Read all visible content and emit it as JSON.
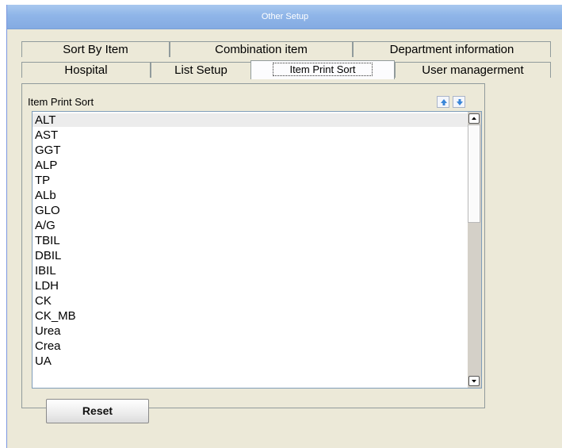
{
  "window": {
    "title": "Other Setup"
  },
  "tabs": {
    "row1": [
      "Sort By Item",
      "Combination item",
      "Department information"
    ],
    "row2": [
      "Hospital",
      "List Setup",
      "Item Print Sort",
      "User managerment"
    ],
    "active": "Item Print Sort"
  },
  "list": {
    "header": "Item Print Sort",
    "move_up_icon": "arrow-up-icon",
    "move_down_icon": "arrow-down-icon",
    "selected": "ALT",
    "items": [
      "ALT",
      "AST",
      "GGT",
      "ALP",
      "TP",
      "ALb",
      "GLO",
      "A/G",
      "TBIL",
      "DBIL",
      "IBIL",
      "LDH",
      "CK",
      "CK_MB",
      "Urea",
      "Crea",
      "UA"
    ],
    "scroll_fraction": 0
  },
  "buttons": {
    "reset_label": "Reset"
  },
  "colors": {
    "titlebar": "#8fb5e8",
    "window_bg": "#ece9d8",
    "arrow_icon": "#3a86d8"
  }
}
